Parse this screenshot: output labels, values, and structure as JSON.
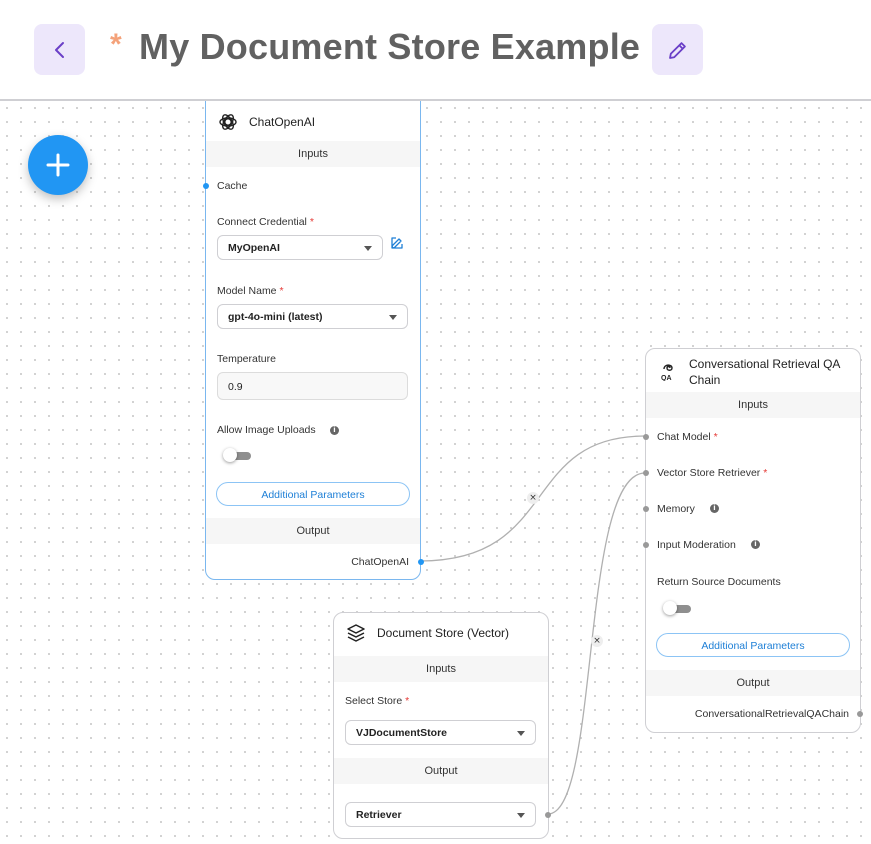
{
  "header": {
    "unsaved_marker": "*",
    "title": "My Document Store Example"
  },
  "nodes": {
    "chat_openai": {
      "title": "ChatOpenAI",
      "inputs_label": "Inputs",
      "cache_label": "Cache",
      "credential_label": "Connect Credential",
      "credential_value": "MyOpenAI",
      "model_label": "Model Name",
      "model_value": "gpt-4o-mini (latest)",
      "temperature_label": "Temperature",
      "temperature_value": "0.9",
      "image_uploads_label": "Allow Image Uploads",
      "image_uploads_enabled": false,
      "additional_params": "Additional Parameters",
      "output_label": "Output",
      "output_name": "ChatOpenAI"
    },
    "qa_chain": {
      "title_line1": "Conversational Retrieval QA",
      "title_line2": "Chain",
      "inputs_label": "Inputs",
      "chat_model_label": "Chat Model",
      "vector_retriever_label": "Vector Store Retriever",
      "memory_label": "Memory",
      "moderation_label": "Input Moderation",
      "return_docs_label": "Return Source Documents",
      "return_docs_enabled": false,
      "additional_params": "Additional Parameters",
      "output_label": "Output",
      "output_name": "ConversationalRetrievalQAChain"
    },
    "doc_store": {
      "title": "Document Store (Vector)",
      "inputs_label": "Inputs",
      "select_store_label": "Select Store",
      "store_value": "VJDocumentStore",
      "output_label": "Output",
      "output_value": "Retriever"
    }
  },
  "required_marker": "*",
  "edge_delete_glyph": "×",
  "info_glyph": "i",
  "colors": {
    "accent": "#2196f3",
    "header_button_bg": "#ede7fb",
    "icon_purple": "#6a3fc7",
    "unsaved": "#f4a27a"
  }
}
